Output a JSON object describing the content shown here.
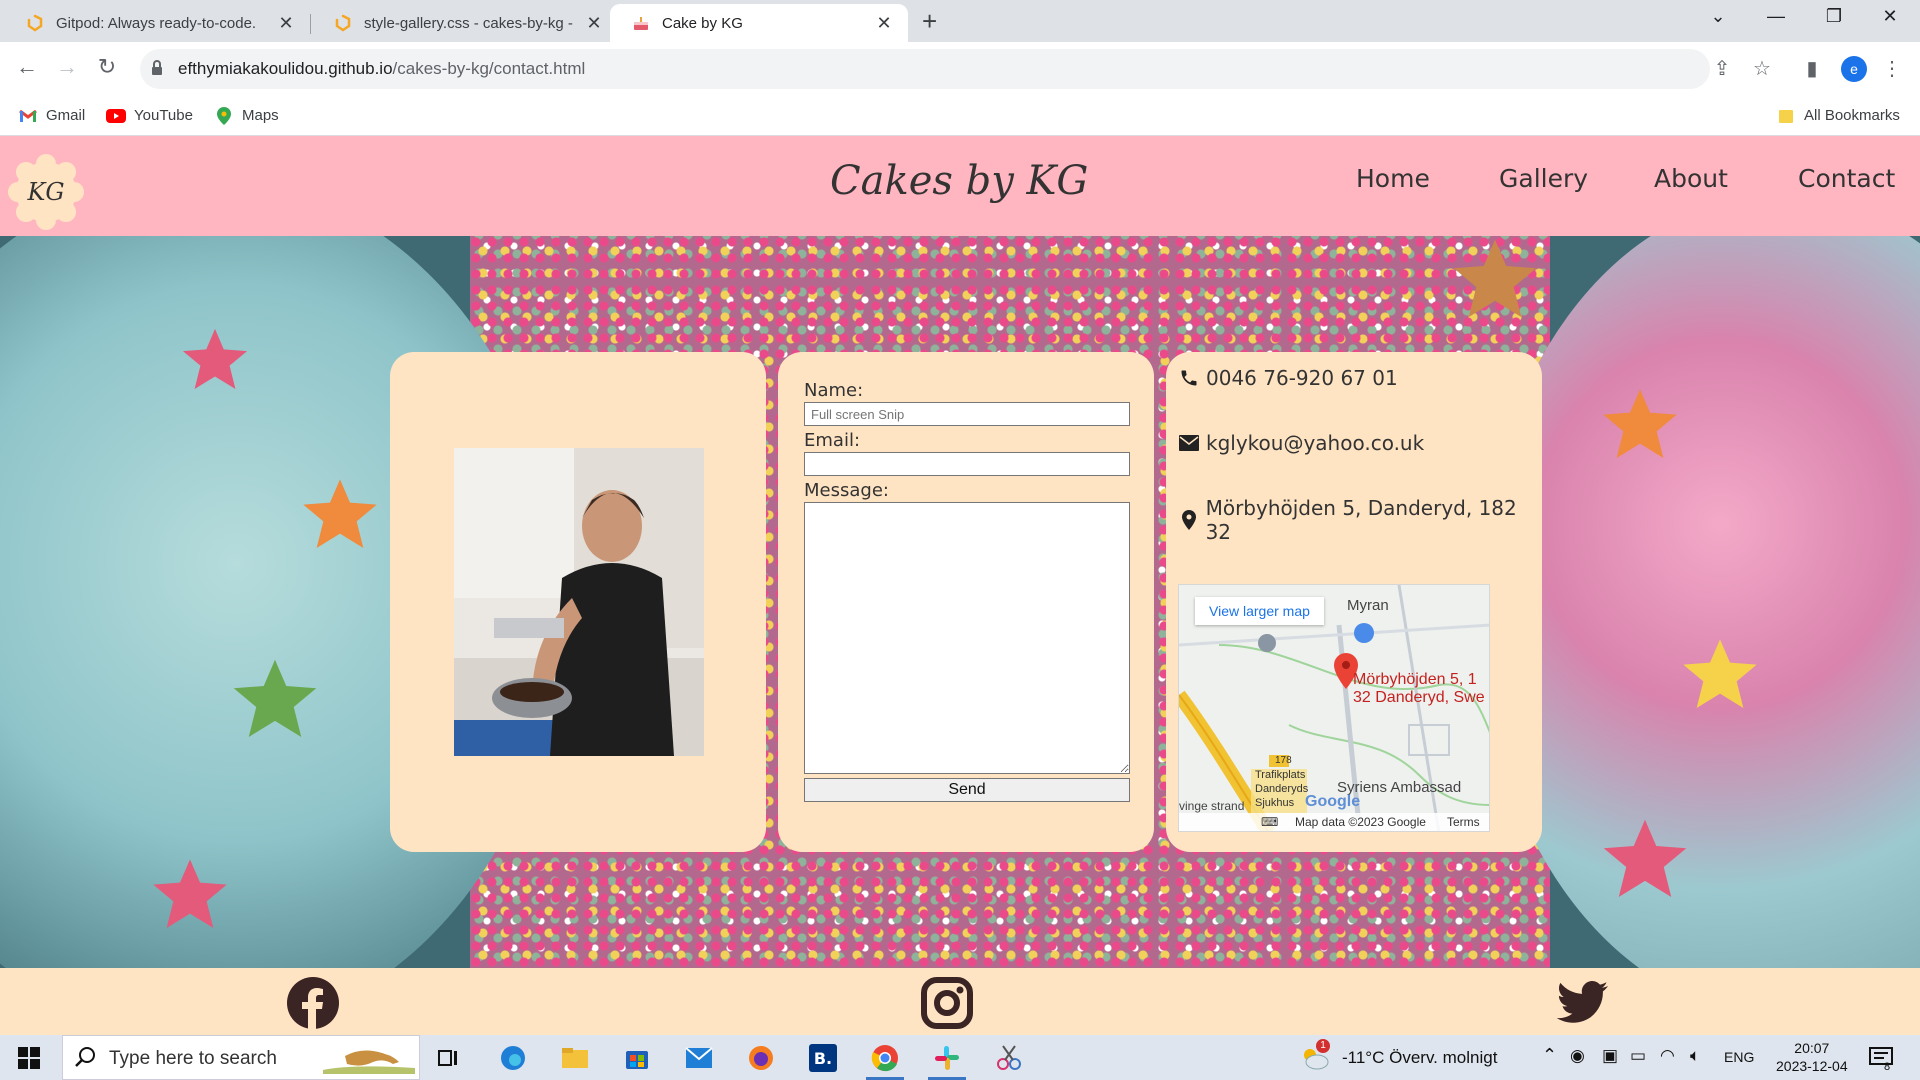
{
  "browser": {
    "tabs": [
      {
        "title": "Gitpod: Always ready-to-code.",
        "active": false
      },
      {
        "title": "style-gallery.css - cakes-by-kg -",
        "active": false
      },
      {
        "title": "Cake by KG",
        "active": true
      }
    ],
    "url_host": "efthymiakakoulidou.github.io",
    "url_path": "/cakes-by-kg/contact.html",
    "profile_initial": "e",
    "bookmarks": [
      "Gmail",
      "YouTube",
      "Maps"
    ],
    "all_bookmarks": "All Bookmarks"
  },
  "site": {
    "logo_text": "KG",
    "title": "Cakes by KG",
    "nav": [
      "Home",
      "Gallery",
      "About",
      "Contact"
    ]
  },
  "form": {
    "name_label": "Name:",
    "name_overlay": "Full screen Snip",
    "email_label": "Email:",
    "message_label": "Message:",
    "send_label": "Send"
  },
  "contact": {
    "phone": "0046 76-920 67 01",
    "email": "kglykou@yahoo.co.uk",
    "address": "Mörbyhöjden 5, Danderyd, 182 32"
  },
  "map": {
    "view_larger": "View larger map",
    "place_label_1": "Myran",
    "address_line_1": "Mörbyhöjden 5, 1",
    "address_line_2": "32 Danderyd, Swe",
    "place_label_2": "Syriens Ambassad",
    "road_number": "178",
    "poi_1": "Trafikplats",
    "poi_2": "Danderyds",
    "poi_3": "Sjukhus",
    "edge_text": "vinge strand",
    "google": "Google",
    "map_data": "Map data ©2023 Google",
    "terms": "Terms"
  },
  "taskbar": {
    "search_placeholder": "Type here to search",
    "weather": "-11°C  Överv. molnigt",
    "weather_badge": "1",
    "language": "ENG",
    "time": "20:07",
    "date": "2023-12-04",
    "notif_count": "8"
  },
  "colors": {
    "header_pink": "#ffb6c1",
    "card_bg": "#ffe4c4",
    "footer_bg": "#ffe4c4"
  }
}
